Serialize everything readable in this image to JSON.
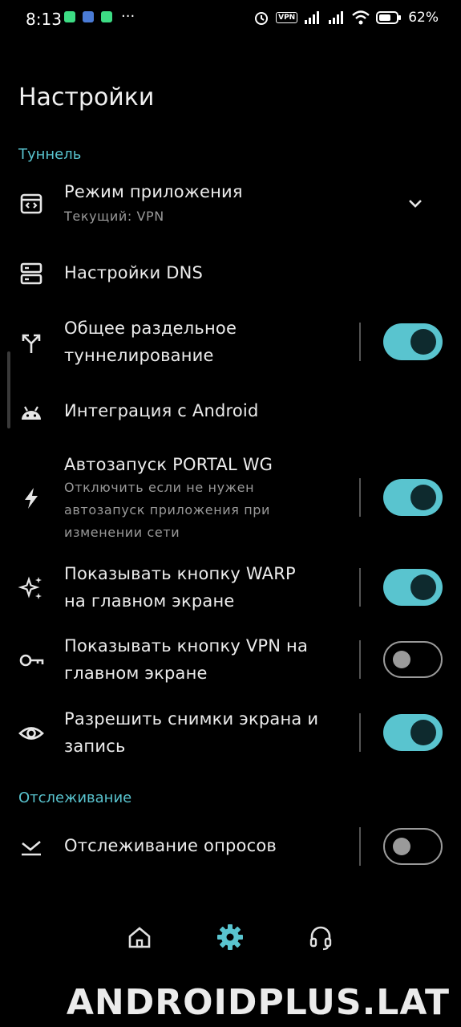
{
  "status_bar": {
    "time": "8:13",
    "vpn_badge": "VPN",
    "battery_pct": "62%",
    "more": "···"
  },
  "page_title": "Настройки",
  "sections": {
    "tunnel": "Туннель",
    "monitoring": "Отслеживание"
  },
  "items": {
    "app_mode": {
      "title": "Режим приложения",
      "subtitle": "Текущий: VPN"
    },
    "dns": {
      "title": "Настройки DNS"
    },
    "split_tunnel": {
      "title_l1": "Общее раздельное",
      "title_l2": "туннелирование",
      "enabled": true
    },
    "android_integration": {
      "title": "Интеграция с Android"
    },
    "autostart": {
      "title": "Автозапуск PORTAL WG",
      "sub_l1": "Отключить если не нужен",
      "sub_l2": "автозапуск приложения при",
      "sub_l3": "изменении сети",
      "enabled": true
    },
    "show_warp": {
      "title_l1": "Показывать кнопку WARP",
      "title_l2": "на главном экране",
      "enabled": true
    },
    "show_vpn": {
      "title_l1": "Показывать кнопку VPN на",
      "title_l2": "главном экране",
      "enabled": false
    },
    "screenshots": {
      "title_l1": "Разрешить снимки экрана и",
      "title_l2": "запись",
      "enabled": true
    },
    "ping_monitoring": {
      "title": "Отслеживание опросов",
      "enabled": false
    }
  },
  "colors": {
    "accent": "#59c4cf",
    "background": "#000000",
    "text": "#ececec",
    "subtext": "#9a9a9a"
  },
  "icons": {
    "app_mode": "app-window-icon",
    "dns": "server-icon",
    "split_tunnel": "split-arrows-icon",
    "android": "android-icon",
    "autostart": "bolt-icon",
    "warp": "sparkles-icon",
    "vpn": "key-icon",
    "screenshots": "eye-icon",
    "monitoring": "monitor-check-icon"
  },
  "bottom_nav": [
    "home-icon",
    "settings-icon",
    "support-icon"
  ],
  "watermark": "ANDROIDPLUS.LAT"
}
